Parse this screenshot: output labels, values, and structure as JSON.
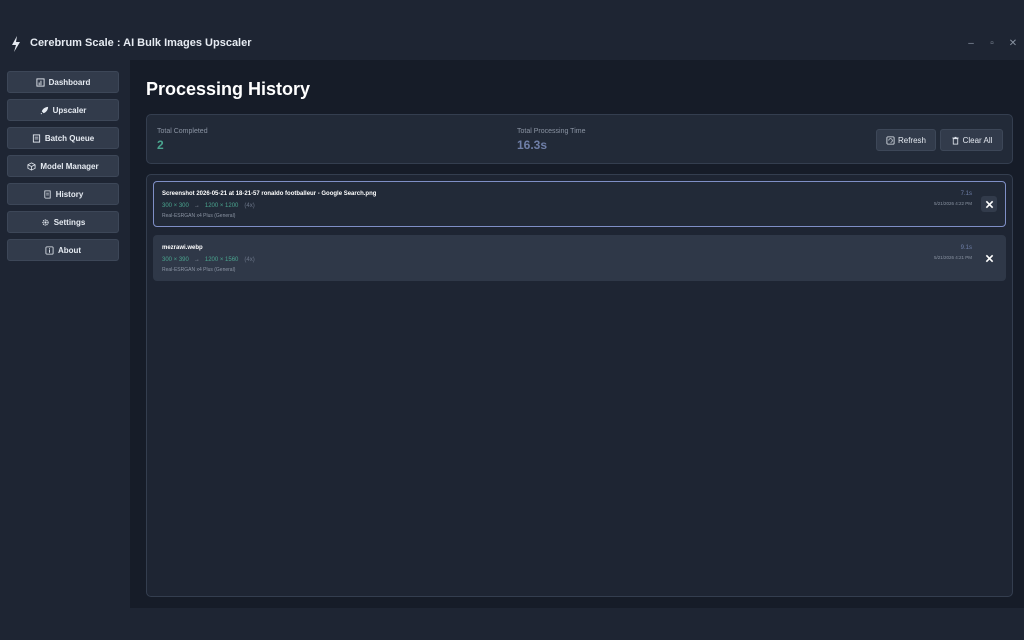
{
  "window": {
    "title": "Cerebrum Scale : AI Bulk Images Upscaler",
    "controls": {
      "minimize": "–",
      "maximize": "▫",
      "close": "✕"
    }
  },
  "sidebar": {
    "items": [
      {
        "label": "Dashboard",
        "icon": "dashboard-icon"
      },
      {
        "label": "Upscaler",
        "icon": "rocket-icon"
      },
      {
        "label": "Batch Queue",
        "icon": "queue-icon"
      },
      {
        "label": "Model Manager",
        "icon": "cube-icon"
      },
      {
        "label": "History",
        "icon": "scroll-icon"
      },
      {
        "label": "Settings",
        "icon": "gear-icon"
      },
      {
        "label": "About",
        "icon": "info-icon"
      }
    ]
  },
  "main": {
    "title": "Processing History",
    "stats": {
      "completed_label": "Total Completed",
      "completed_value": "2",
      "time_label": "Total Processing Time",
      "time_value": "16.3s"
    },
    "actions": {
      "refresh": "Refresh",
      "clear_all": "Clear All"
    },
    "history": [
      {
        "name": "Screenshot 2026-05-21 at 18-21-57 ronaldo footballeur - Google Search.png",
        "src": "300 × 300",
        "arrow": "→",
        "dst": "1200 × 1200",
        "scale": "(4x)",
        "model": "Real-ESRGAN x4 Plus (General)",
        "time": "7.1s",
        "date": "5/21/2026 4:22 PM"
      },
      {
        "name": "mezrawi.webp",
        "src": "300 × 390",
        "arrow": "→",
        "dst": "1200 × 1560",
        "scale": "(4x)",
        "model": "Real-ESRGAN x4 Plus (General)",
        "time": "9.1s",
        "date": "5/21/2026 4:21 PM"
      }
    ]
  },
  "colors": {
    "accent_green": "#4aa58f",
    "accent_blue": "#6f7fa8",
    "selected_border": "#7f8fc6",
    "panel": "#222a38"
  }
}
